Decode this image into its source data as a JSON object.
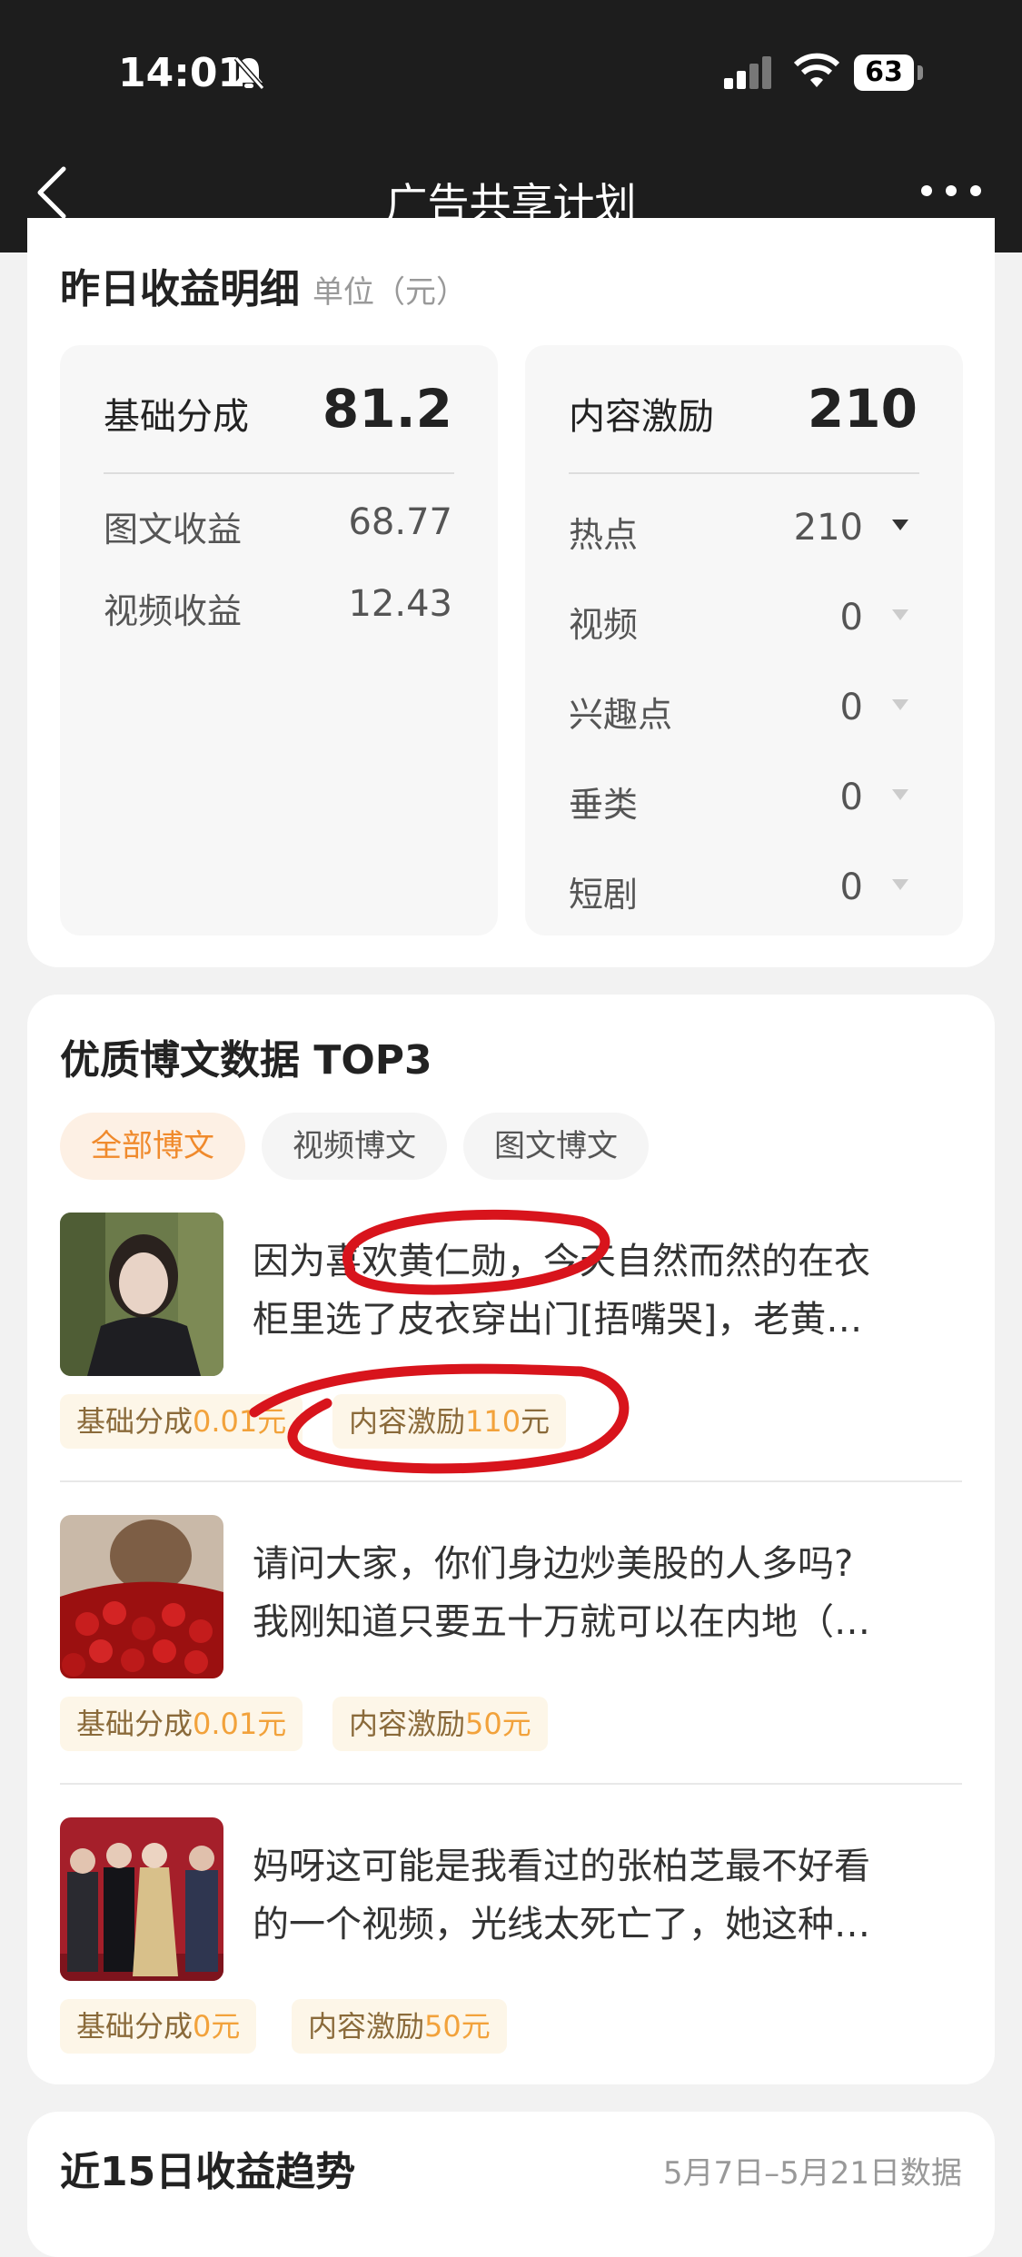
{
  "status_bar": {
    "time": "14:01",
    "battery": "63"
  },
  "nav": {
    "title": "广告共享计划"
  },
  "earnings": {
    "title": "昨日收益明细",
    "unit": "单位（元）",
    "basic": {
      "label": "基础分成",
      "value": "81.2",
      "rows": [
        {
          "label": "图文收益",
          "value": "68.77"
        },
        {
          "label": "视频收益",
          "value": "12.43"
        }
      ]
    },
    "content": {
      "label": "内容激励",
      "value": "210",
      "rows": [
        {
          "label": "热点",
          "value": "210"
        },
        {
          "label": "视频",
          "value": "0"
        },
        {
          "label": "兴趣点",
          "value": "0"
        },
        {
          "label": "垂类",
          "value": "0"
        },
        {
          "label": "短剧",
          "value": "0"
        }
      ]
    }
  },
  "top_posts": {
    "title": "优质博文数据 TOP3",
    "tabs": [
      "全部博文",
      "视频博文",
      "图文博文"
    ],
    "basic_prefix": "基础分成",
    "content_prefix": "内容激励",
    "currency": "元",
    "items": [
      {
        "line1": "因为喜欢黄仁勋，今天自然而然的在衣",
        "line2": "柜里选了皮衣穿出门[捂嘴哭]，老黄…",
        "basic": "0.01",
        "content": "110"
      },
      {
        "line1": "请问大家，你们身边炒美股的人多吗?",
        "line2": "我刚知道只要五十万就可以在内地（…",
        "basic": "0.01",
        "content": "50"
      },
      {
        "line1": "妈呀这可能是我看过的张柏芝最不好看",
        "line2": "的一个视频，光线太死亡了，她这种…",
        "basic": "0",
        "content": "50"
      }
    ]
  },
  "trend": {
    "title": "近15日收益趋势",
    "range": "5月7日–5月21日数据"
  }
}
